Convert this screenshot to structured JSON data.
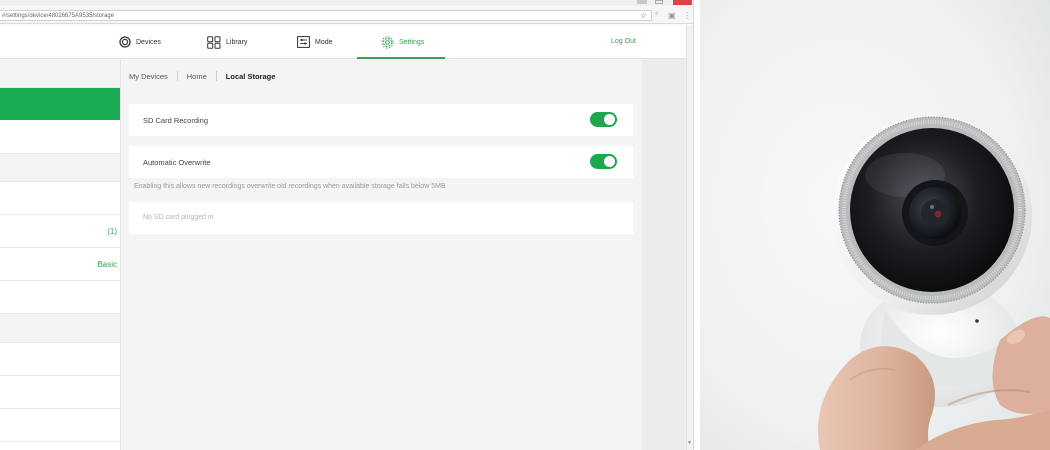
{
  "browser": {
    "url": "#/settings/device/48026675A9535/storage"
  },
  "nav": {
    "items": [
      {
        "label": "Devices",
        "icon": "camera-circle-icon"
      },
      {
        "label": "Library",
        "icon": "grid-icon"
      },
      {
        "label": "Mode",
        "icon": "sliders-icon"
      },
      {
        "label": "Settings",
        "icon": "gear-icon"
      }
    ],
    "active": "Settings",
    "logout_label": "Log Out"
  },
  "sidebar": {
    "badge": "(1)",
    "plan": "Basic"
  },
  "breadcrumb": {
    "items": [
      "My Devices",
      "Home",
      "Local Storage"
    ]
  },
  "storage": {
    "sd_recording_label": "SD Card Recording",
    "sd_recording_on": true,
    "overwrite_label": "Automatic Overwrite",
    "overwrite_on": true,
    "overwrite_hint": "Enabling this allows new recordings overwrite old recordings when available storage falls below 5MB",
    "no_sd_text": "No SD card plugged in"
  },
  "colors": {
    "accent": "#2fa553",
    "toggle_on": "#1fa74d",
    "sidebar_active": "#19ac52"
  }
}
